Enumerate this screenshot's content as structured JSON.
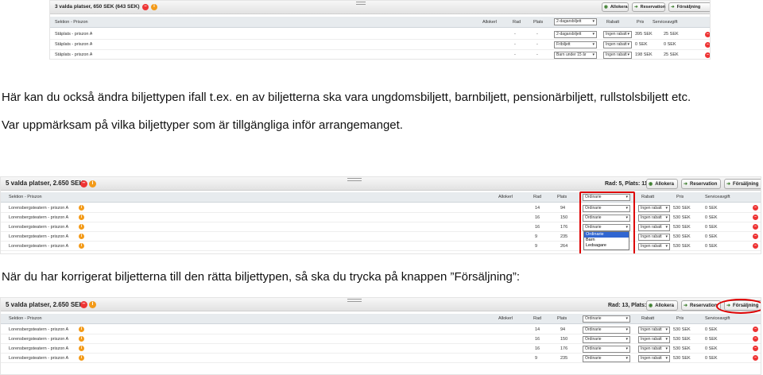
{
  "shot1": {
    "title": "3 valda platser, 650 SEK (643 SEK)",
    "toolbar": {
      "allocate": "Allokera",
      "reservation": "Reservation",
      "sale": "Försäljning"
    },
    "columns": [
      "Sektion - Priszon",
      "Allokerl",
      "Rad",
      "Plats",
      "",
      "Rabatt",
      "Pris",
      "Serviceavgift"
    ],
    "ticket_type_header": "2-dagarsbiljett",
    "rows": [
      {
        "section": "Ståplats - priszon A",
        "rad": "-",
        "plats": "-",
        "ticket": "2-dagarsbiljett",
        "rabatt": "Ingen rabatt",
        "pris": "395 SEK",
        "avgift": "25 SEK"
      },
      {
        "section": "Ståplats - priszon A",
        "rad": "-",
        "plats": "-",
        "ticket": "Fribiljett",
        "rabatt": "Ingen rabatt",
        "pris": "0 SEK",
        "avgift": "0 SEK"
      },
      {
        "section": "Ståplats - priszon A",
        "rad": "-",
        "plats": "-",
        "ticket": "Barn under 15 år",
        "rabatt": "Ingen rabatt",
        "pris": "198 SEK",
        "avgift": "25 SEK"
      }
    ]
  },
  "text1": "Här kan du också ändra biljettypen ifall t.ex. en av biljetterna ska vara ungdomsbiljett, barnbiljett, pensionärbiljett, rullstolsbiljett etc.",
  "text2": "Var uppmärksam på vilka biljettyper som är tillgängliga inför arrangemanget.",
  "shot2": {
    "title": "5 valda platser, 2.650 SEK",
    "info": "Rad: 5, Plats: 111",
    "toolbar": {
      "allocate": "Allokera",
      "reservation": "Reservation",
      "sale": "Försäljning"
    },
    "columns": [
      "Sektion - Priszon",
      "Allokerl",
      "Rad",
      "Plats",
      "",
      "Rabatt",
      "Pris",
      "Serviceavgift"
    ],
    "ticket_type_header": "Ordinarie",
    "rows": [
      {
        "section": "Lorensbergsteatern - priszon A",
        "rad": "14",
        "plats": "94",
        "ticket": "Ordinarie",
        "rabatt": "Ingen rabatt",
        "pris": "530 SEK",
        "avgift": "0 SEK"
      },
      {
        "section": "Lorensbergsteatern - priszon A",
        "rad": "16",
        "plats": "150",
        "ticket": "Ordinarie",
        "rabatt": "Ingen rabatt",
        "pris": "530 SEK",
        "avgift": "0 SEK"
      },
      {
        "section": "Lorensbergsteatern - priszon A",
        "rad": "16",
        "plats": "176",
        "ticket": "Ordinarie",
        "rabatt": "Ingen rabatt",
        "pris": "530 SEK",
        "avgift": "0 SEK"
      },
      {
        "section": "Lorensbergsteatern - priszon A",
        "rad": "9",
        "plats": "235",
        "ticket": "",
        "rabatt": "Ingen rabatt",
        "pris": "530 SEK",
        "avgift": "0 SEK"
      },
      {
        "section": "Lorensbergsteatern - priszon A",
        "rad": "9",
        "plats": "264",
        "ticket": "",
        "rabatt": "Ingen rabatt",
        "pris": "530 SEK",
        "avgift": "0 SEK"
      }
    ],
    "dropdown_options": [
      "Ordinarie",
      "Barn",
      "Ledsagare"
    ]
  },
  "text3": "När du har korrigerat biljetterna till den rätta biljettypen, så ska du trycka på knappen ”Försäljning”:",
  "shot3": {
    "title": "5 valda platser, 2.650 SEK",
    "info": "Rad: 13, Plats: 61",
    "toolbar": {
      "allocate": "Allokera",
      "reservation": "Reservation",
      "sale": "Försäljning"
    },
    "columns": [
      "Sektion - Priszon",
      "Allokerl",
      "Rad",
      "Plats",
      "",
      "Rabatt",
      "Pris",
      "Serviceavgift"
    ],
    "ticket_type_header": "Ordinarie",
    "rows": [
      {
        "section": "Lorensbergsteatern - priszon A",
        "rad": "14",
        "plats": "94",
        "ticket": "Ordinarie",
        "rabatt": "Ingen rabatt",
        "pris": "530 SEK",
        "avgift": "0 SEK"
      },
      {
        "section": "Lorensbergsteatern - priszon A",
        "rad": "16",
        "plats": "150",
        "ticket": "Ordinarie",
        "rabatt": "Ingen rabatt",
        "pris": "530 SEK",
        "avgift": "0 SEK"
      },
      {
        "section": "Lorensbergsteatern - priszon A",
        "rad": "16",
        "plats": "176",
        "ticket": "Ordinarie",
        "rabatt": "Ingen rabatt",
        "pris": "530 SEK",
        "avgift": "0 SEK"
      },
      {
        "section": "Lorensbergsteatern - priszon A",
        "rad": "9",
        "plats": "235",
        "ticket": "Ordinarie",
        "rabatt": "Ingen rabatt",
        "pris": "530 SEK",
        "avgift": "0 SEK"
      }
    ]
  },
  "colors": {
    "highlight": "#dd0000",
    "delete": "#ee3333",
    "info": "#f39a18",
    "header_bg": "#e7ebee"
  }
}
